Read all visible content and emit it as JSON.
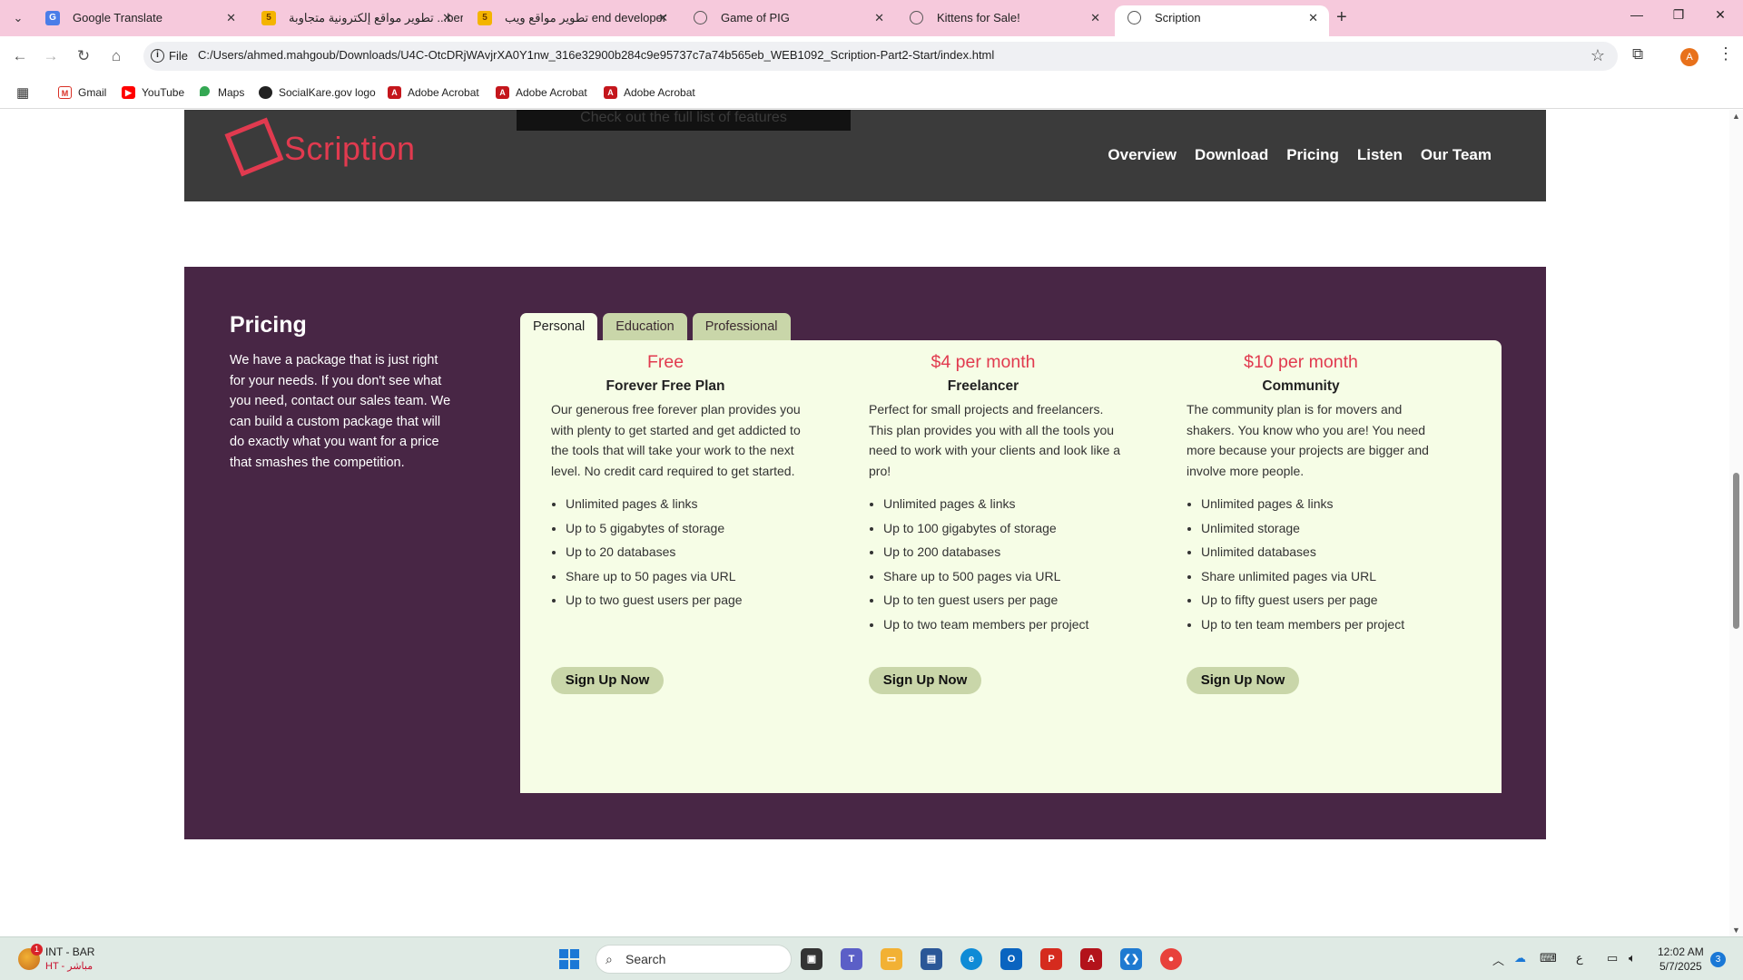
{
  "browser": {
    "tabs": [
      {
        "title": "Google Translate",
        "favicon": "google-translate-icon"
      },
      {
        "title": "تطوير مواقع إلكترونية متجاوبة ...ber",
        "favicon": "w3-icon"
      },
      {
        "title": "تطوير مواقع ويب end developer",
        "favicon": "w3-icon"
      },
      {
        "title": "Game of PIG",
        "favicon": "globe-icon"
      },
      {
        "title": "Kittens for Sale!",
        "favicon": "globe-icon"
      },
      {
        "title": "Scription",
        "favicon": "globe-icon",
        "active": true
      }
    ],
    "address": {
      "scheme_chip": "File",
      "url": "C:/Users/ahmed.mahgoub/Downloads/U4C-OtcDRjWAvjrXA0Y1nw_316e32900b284c9e95737c7a74b565eb_WEB1092_Scription-Part2-Start/index.html"
    },
    "profile_initial": "A",
    "bookmarks": [
      {
        "label": "Gmail",
        "icon": "gmail-icon"
      },
      {
        "label": "YouTube",
        "icon": "youtube-icon"
      },
      {
        "label": "Maps",
        "icon": "maps-icon"
      },
      {
        "label": "SocialKare.gov logo",
        "icon": "socialkare-icon"
      },
      {
        "label": "Adobe Acrobat",
        "icon": "acrobat-icon"
      },
      {
        "label": "Adobe Acrobat",
        "icon": "acrobat-icon"
      },
      {
        "label": "Adobe Acrobat",
        "icon": "acrobat-icon"
      }
    ]
  },
  "site": {
    "features_cta": "Check out the full list of features",
    "logo_text": "Scription",
    "nav": [
      "Overview",
      "Download",
      "Pricing",
      "Listen",
      "Our Team"
    ],
    "brand_color": "#e13a4f",
    "header_bg": "#3b3b3b",
    "section_bg": "#482645"
  },
  "pricing": {
    "title": "Pricing",
    "description": "We have a package that is just right for your needs. If you don't see what you need, contact our sales team. We can build a custom package that will do exactly what you want for a price that smashes the competition.",
    "tabs": [
      {
        "label": "Personal",
        "active": true
      },
      {
        "label": "Education",
        "active": false
      },
      {
        "label": "Professional",
        "active": false
      }
    ],
    "plans": [
      {
        "price": "Free",
        "name": "Forever Free Plan",
        "description": "Our generous free forever plan provides you with plenty to get started and get addicted to the tools that will take your work to the next level. No credit card required to get started.",
        "features": [
          "Unlimited pages & links",
          "Up to 5 gigabytes of storage",
          "Up to 20 databases",
          "Share up to 50 pages via URL",
          "Up to two guest users per page"
        ],
        "cta": "Sign Up Now"
      },
      {
        "price": "$4 per month",
        "name": "Freelancer",
        "description": "Perfect for small projects and freelancers. This plan provides you with all the tools you need to work with your clients and look like a pro!",
        "features": [
          "Unlimited pages & links",
          "Up to 100 gigabytes of storage",
          "Up to 200 databases",
          "Share up to 500 pages via URL",
          "Up to ten guest users per page",
          "Up to two team members per project"
        ],
        "cta": "Sign Up Now"
      },
      {
        "price": "$10 per month",
        "name": "Community",
        "description": "The community plan is for movers and shakers. You know who you are! You need more because your projects are bigger and involve more people.",
        "features": [
          "Unlimited pages & links",
          "Unlimited storage",
          "Unlimited databases",
          "Share unlimited pages via URL",
          "Up to fifty guest users per page",
          "Up to ten team members per project"
        ],
        "cta": "Sign Up Now"
      }
    ]
  },
  "taskbar": {
    "weather_badge": "1",
    "weather_line1": "INT - BAR",
    "weather_line2": "HT - مباشر",
    "search_placeholder": "Search",
    "ime_indicator": "ع",
    "time": "12:02 AM",
    "date": "5/7/2025",
    "notifications": "3"
  }
}
